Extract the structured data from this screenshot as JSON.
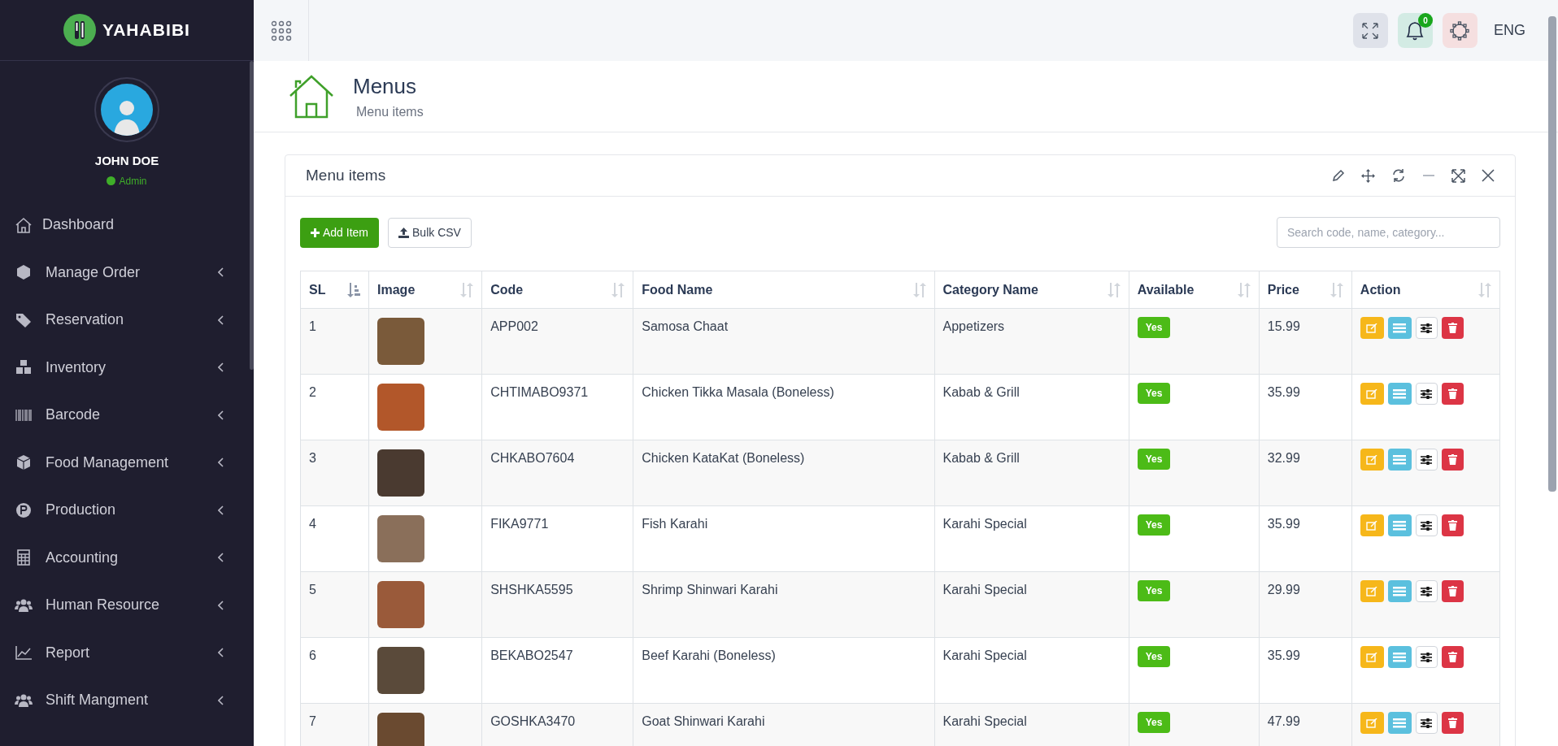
{
  "brand": {
    "name": "YAHABIBI"
  },
  "user": {
    "name": "JOHN DOE",
    "role": "Admin"
  },
  "sidebar": {
    "items": [
      {
        "label": "Dashboard",
        "has_submenu": false
      },
      {
        "label": "Manage Order",
        "has_submenu": true
      },
      {
        "label": "Reservation",
        "has_submenu": true
      },
      {
        "label": "Inventory",
        "has_submenu": true
      },
      {
        "label": "Barcode",
        "has_submenu": true
      },
      {
        "label": "Food Management",
        "has_submenu": true
      },
      {
        "label": "Production",
        "has_submenu": true
      },
      {
        "label": "Accounting",
        "has_submenu": true
      },
      {
        "label": "Human Resource",
        "has_submenu": true
      },
      {
        "label": "Report",
        "has_submenu": true
      },
      {
        "label": "Shift Mangment",
        "has_submenu": true
      }
    ]
  },
  "topbar": {
    "notification_count": "0",
    "language": "ENG"
  },
  "page_header": {
    "title": "Menus",
    "subtitle": "Menu items"
  },
  "panel": {
    "title": "Menu items",
    "buttons": [
      {
        "label": "Add Item",
        "kind": "primary"
      },
      {
        "label": "Bulk CSV",
        "kind": "outline"
      }
    ],
    "search": {
      "placeholder": "Search code, name, category..."
    }
  },
  "table": {
    "columns": [
      {
        "label": "SL",
        "sorted": true
      },
      {
        "label": "Image",
        "sorted": false
      },
      {
        "label": "Code",
        "sorted": false
      },
      {
        "label": "Food Name",
        "sorted": false
      },
      {
        "label": "Category Name",
        "sorted": false
      },
      {
        "label": "Available",
        "sorted": false
      },
      {
        "label": "Price",
        "sorted": false
      },
      {
        "label": "Action",
        "sorted": false
      }
    ],
    "rows": [
      {
        "sl": "1",
        "code": "APP002",
        "food_name": "Samosa Chaat",
        "category": "Appetizers",
        "available": "Yes",
        "price": "15.99"
      },
      {
        "sl": "2",
        "code": "CHTIMABO9371",
        "food_name": "Chicken Tikka Masala (Boneless)",
        "category": "Kabab & Grill",
        "available": "Yes",
        "price": "35.99"
      },
      {
        "sl": "3",
        "code": "CHKABO7604",
        "food_name": "Chicken KataKat (Boneless)",
        "category": "Kabab & Grill",
        "available": "Yes",
        "price": "32.99"
      },
      {
        "sl": "4",
        "code": "FIKA9771",
        "food_name": "Fish Karahi",
        "category": "Karahi Special",
        "available": "Yes",
        "price": "35.99"
      },
      {
        "sl": "5",
        "code": "SHSHKA5595",
        "food_name": "Shrimp Shinwari Karahi",
        "category": "Karahi Special",
        "available": "Yes",
        "price": "29.99"
      },
      {
        "sl": "6",
        "code": "BEKABO2547",
        "food_name": "Beef Karahi (Boneless)",
        "category": "Karahi Special",
        "available": "Yes",
        "price": "35.99"
      },
      {
        "sl": "7",
        "code": "GOSHKA3470",
        "food_name": "Goat Shinwari Karahi",
        "category": "Karahi Special",
        "available": "Yes",
        "price": "47.99"
      }
    ]
  }
}
